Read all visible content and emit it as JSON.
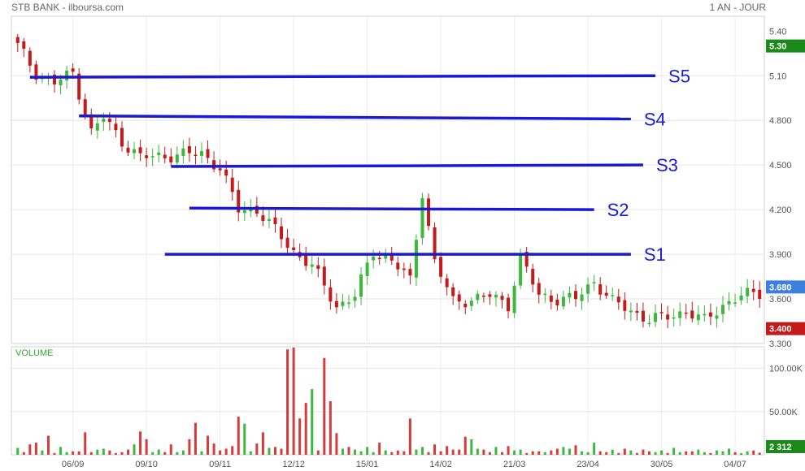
{
  "header": {
    "title": "STB BANK - ilboursa.com",
    "period": "1 AN - JOUR"
  },
  "chart_data": {
    "type": "candlestick",
    "price_axis": {
      "ticks": [
        "5.40",
        "5.10",
        "4.800",
        "4.500",
        "4.200",
        "3.900",
        "3.600",
        "3.300"
      ],
      "tick_values": [
        5.4,
        5.1,
        4.8,
        4.5,
        4.2,
        3.9,
        3.6,
        3.3
      ],
      "ylim": [
        3.3,
        5.5
      ]
    },
    "volume_axis": {
      "label": "VOLUME",
      "ticks": [
        "100.00K",
        "50.00K"
      ],
      "tick_values": [
        100000,
        50000
      ],
      "ylim": [
        0,
        125000
      ]
    },
    "x_ticks": [
      "06/09",
      "09/10",
      "09/11",
      "12/12",
      "15/01",
      "14/02",
      "21/03",
      "23/04",
      "30/05",
      "04/07"
    ],
    "badges": [
      {
        "text": "5.30",
        "value": 5.3,
        "color": "#1b8a1b",
        "axis": "price"
      },
      {
        "text": "3.680",
        "value": 3.68,
        "color": "#3d7ee0",
        "axis": "price"
      },
      {
        "text": "3.400",
        "value": 3.4,
        "color": "#c41a1a",
        "axis": "price"
      },
      {
        "text": "2 312",
        "value": 2312,
        "color": "#1b8a1b",
        "axis": "volume"
      }
    ],
    "support_lines": [
      {
        "name": "S5",
        "start_index": 2,
        "end_index": 104,
        "start_value": 5.09,
        "end_value": 5.1
      },
      {
        "name": "S4",
        "start_index": 10,
        "end_index": 100,
        "start_value": 4.83,
        "end_value": 4.81
      },
      {
        "name": "S3",
        "start_index": 25,
        "end_index": 102,
        "start_value": 4.49,
        "end_value": 4.5
      },
      {
        "name": "S2",
        "start_index": 28,
        "end_index": 94,
        "start_value": 4.21,
        "end_value": 4.2
      },
      {
        "name": "S1",
        "start_index": 24,
        "end_index": 100,
        "start_value": 3.9,
        "end_value": 3.9
      }
    ],
    "close_anchors": [
      [
        0,
        5.3
      ],
      [
        3,
        5.12
      ],
      [
        6,
        5.05
      ],
      [
        9,
        5.12
      ],
      [
        12,
        4.72
      ],
      [
        14,
        4.82
      ],
      [
        17,
        4.66
      ],
      [
        20,
        4.55
      ],
      [
        23,
        4.56
      ],
      [
        27,
        4.57
      ],
      [
        30,
        4.58
      ],
      [
        33,
        4.48
      ],
      [
        36,
        4.2
      ],
      [
        39,
        4.2
      ],
      [
        42,
        4.06
      ],
      [
        45,
        3.92
      ],
      [
        48,
        3.82
      ],
      [
        52,
        3.55
      ],
      [
        55,
        3.62
      ],
      [
        58,
        3.92
      ],
      [
        61,
        3.86
      ],
      [
        64,
        3.72
      ],
      [
        66,
        4.32
      ],
      [
        68,
        3.85
      ],
      [
        71,
        3.58
      ],
      [
        74,
        3.6
      ],
      [
        77,
        3.62
      ],
      [
        80,
        3.56
      ],
      [
        82,
        3.88
      ],
      [
        85,
        3.62
      ],
      [
        88,
        3.6
      ],
      [
        91,
        3.6
      ],
      [
        94,
        3.72
      ],
      [
        97,
        3.58
      ],
      [
        100,
        3.52
      ],
      [
        103,
        3.46
      ],
      [
        106,
        3.48
      ],
      [
        109,
        3.52
      ],
      [
        112,
        3.45
      ],
      [
        115,
        3.56
      ],
      [
        118,
        3.62
      ],
      [
        121,
        3.64
      ],
      [
        124,
        3.68
      ]
    ],
    "volume_values": [
      8000,
      3000,
      12000,
      14000,
      5000,
      22000,
      2000,
      9000,
      3000,
      4000,
      4000,
      26000,
      3000,
      6000,
      7000,
      5000,
      2000,
      3000,
      6000,
      12000,
      27000,
      18000,
      3000,
      6000,
      3000,
      12000,
      3000,
      5000,
      18000,
      37000,
      4000,
      22000,
      13000,
      5000,
      7000,
      10000,
      44000,
      36000,
      4000,
      13000,
      26000,
      8000,
      9000,
      7000,
      122000,
      124000,
      42000,
      60000,
      76000,
      5000,
      112000,
      62000,
      25000,
      7000,
      9000,
      6000,
      4000,
      9000,
      3000,
      14000,
      5000,
      3000,
      5000,
      4000,
      42000,
      6000,
      9000,
      3000,
      12000,
      4000,
      10000,
      6000,
      6000,
      21000,
      18000,
      7000,
      6000,
      3000,
      9000,
      3000,
      10000,
      5000,
      6000,
      2000,
      4000,
      4000,
      3000,
      5000,
      7000,
      9000,
      7000,
      11000,
      4000,
      3000,
      14000,
      4000,
      3000,
      6000,
      2000,
      7000,
      5000,
      2000,
      6000,
      4000,
      3000,
      5000,
      2000,
      8000,
      3000,
      4000,
      4000,
      6000,
      3000,
      2000,
      5000,
      4000,
      7000,
      3000,
      2000,
      4000,
      5000,
      2312
    ]
  }
}
